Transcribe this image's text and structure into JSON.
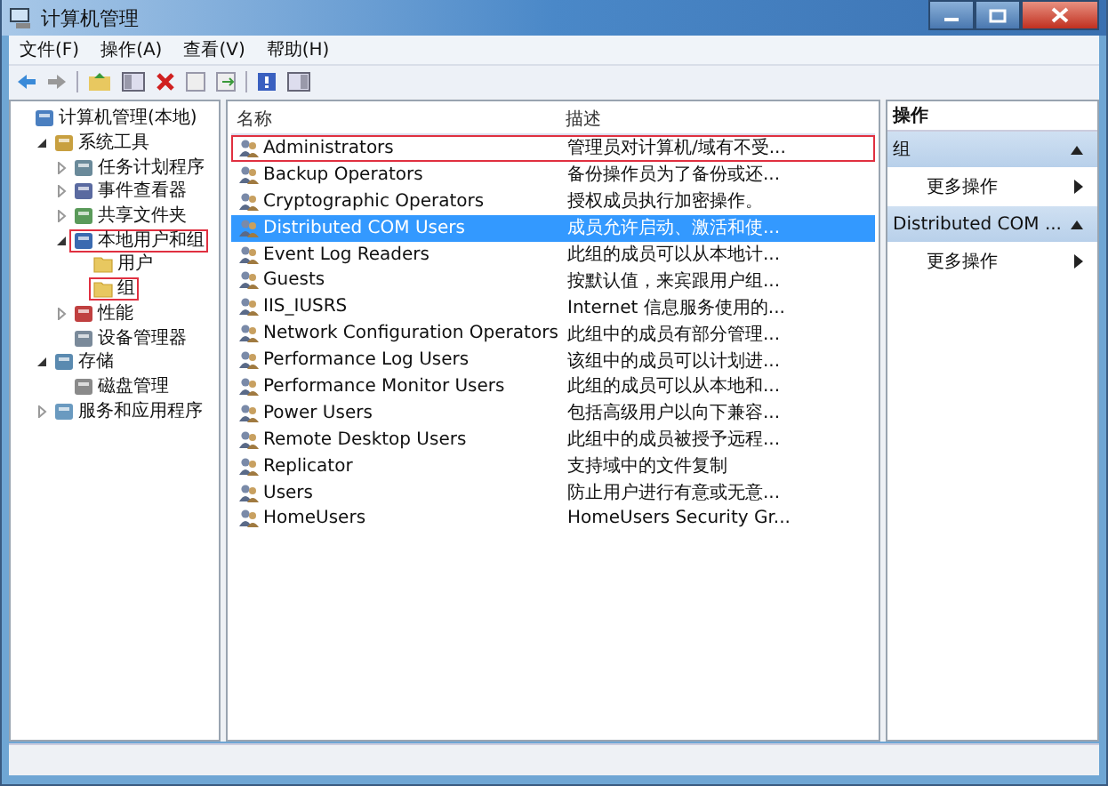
{
  "window": {
    "title": "计算机管理"
  },
  "menu": [
    "文件(F)",
    "操作(A)",
    "查看(V)",
    "帮助(H)"
  ],
  "tree": [
    {
      "label": "计算机管理(本地)",
      "kind": "computer",
      "highlighted": false,
      "children": [
        {
          "label": "系统工具",
          "kind": "tools",
          "expanded": true,
          "highlighted": false,
          "children": [
            {
              "label": "任务计划程序",
              "kind": "clock",
              "expanded": false,
              "highlighted": false
            },
            {
              "label": "事件查看器",
              "kind": "log",
              "expanded": false,
              "highlighted": false
            },
            {
              "label": "共享文件夹",
              "kind": "share",
              "expanded": false,
              "highlighted": false
            },
            {
              "label": "本地用户和组",
              "kind": "users",
              "expanded": true,
              "highlighted": true,
              "children": [
                {
                  "label": "用户",
                  "kind": "folder",
                  "highlighted": false
                },
                {
                  "label": "组",
                  "kind": "folder",
                  "highlighted": true
                }
              ]
            },
            {
              "label": "性能",
              "kind": "perf",
              "expanded": false,
              "highlighted": false
            },
            {
              "label": "设备管理器",
              "kind": "device",
              "highlighted": false
            }
          ]
        },
        {
          "label": "存储",
          "kind": "storage",
          "expanded": true,
          "highlighted": false,
          "children": [
            {
              "label": "磁盘管理",
              "kind": "disk",
              "highlighted": false
            }
          ]
        },
        {
          "label": "服务和应用程序",
          "kind": "services",
          "expanded": false,
          "highlighted": false
        }
      ]
    }
  ],
  "list": {
    "columns": [
      "名称",
      "描述"
    ],
    "rows": [
      {
        "name": "Administrators",
        "description": "管理员对计算机/域有不受...",
        "selected": false,
        "highlighted": true
      },
      {
        "name": "Backup Operators",
        "description": "备份操作员为了备份或还...",
        "selected": false,
        "highlighted": false
      },
      {
        "name": "Cryptographic Operators",
        "description": "授权成员执行加密操作。",
        "selected": false,
        "highlighted": false
      },
      {
        "name": "Distributed COM Users",
        "description": "成员允许启动、激活和使...",
        "selected": true,
        "highlighted": false
      },
      {
        "name": "Event Log Readers",
        "description": "此组的成员可以从本地计...",
        "selected": false,
        "highlighted": false
      },
      {
        "name": "Guests",
        "description": "按默认值，来宾跟用户组...",
        "selected": false,
        "highlighted": false
      },
      {
        "name": "IIS_IUSRS",
        "description": "Internet 信息服务使用的...",
        "selected": false,
        "highlighted": false
      },
      {
        "name": "Network Configuration Operators",
        "description": "此组中的成员有部分管理...",
        "selected": false,
        "highlighted": false
      },
      {
        "name": "Performance Log Users",
        "description": "该组中的成员可以计划进...",
        "selected": false,
        "highlighted": false
      },
      {
        "name": "Performance Monitor Users",
        "description": "此组的成员可以从本地和...",
        "selected": false,
        "highlighted": false
      },
      {
        "name": "Power Users",
        "description": "包括高级用户以向下兼容...",
        "selected": false,
        "highlighted": false
      },
      {
        "name": "Remote Desktop Users",
        "description": "此组中的成员被授予远程...",
        "selected": false,
        "highlighted": false
      },
      {
        "name": "Replicator",
        "description": "支持域中的文件复制",
        "selected": false,
        "highlighted": false
      },
      {
        "name": "Users",
        "description": "防止用户进行有意或无意...",
        "selected": false,
        "highlighted": false
      },
      {
        "name": "HomeUsers",
        "description": "HomeUsers Security Gr...",
        "selected": false,
        "highlighted": false
      }
    ]
  },
  "actions": {
    "title": "操作",
    "sections": [
      {
        "title": "组",
        "items": [
          "更多操作"
        ]
      },
      {
        "title": "Distributed COM ...",
        "items": [
          "更多操作"
        ]
      }
    ]
  }
}
